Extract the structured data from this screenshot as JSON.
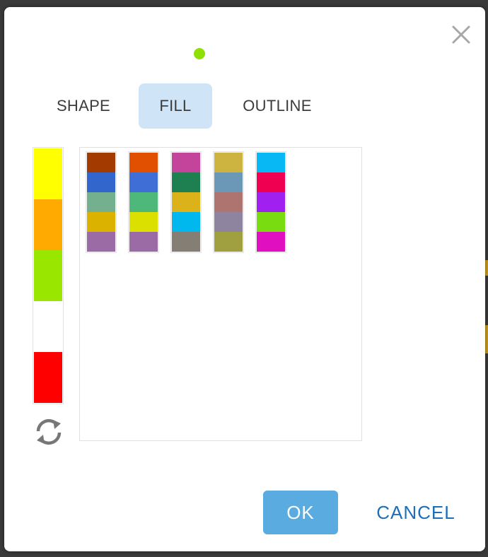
{
  "dialog": {
    "close_icon": "close-icon",
    "preview_color": "#8de000"
  },
  "tabs": [
    {
      "label": "SHAPE",
      "active": false
    },
    {
      "label": "FILL",
      "active": true
    },
    {
      "label": "OUTLINE",
      "active": false
    }
  ],
  "recent_colors": [
    "#ffff00",
    "#ffaa00",
    "#99e600",
    "#ffffff",
    "#ff0000"
  ],
  "refresh_icon": "refresh-icon",
  "palettes": [
    [
      "#a33a00",
      "#3366cc",
      "#74b08d",
      "#dcb200",
      "#9b6ba5"
    ],
    [
      "#e05000",
      "#3f6fd6",
      "#4db87a",
      "#dbe000",
      "#9b6ba5"
    ],
    [
      "#c4449b",
      "#1e8050",
      "#dcb21a",
      "#00b7ee",
      "#857e75"
    ],
    [
      "#cdb440",
      "#6c98b8",
      "#ad7470",
      "#8f84a0",
      "#a0a040"
    ],
    [
      "#08b8f5",
      "#f00050",
      "#a020f0",
      "#78dc10",
      "#e010c0"
    ]
  ],
  "footer": {
    "ok_label": "OK",
    "cancel_label": "CANCEL"
  }
}
